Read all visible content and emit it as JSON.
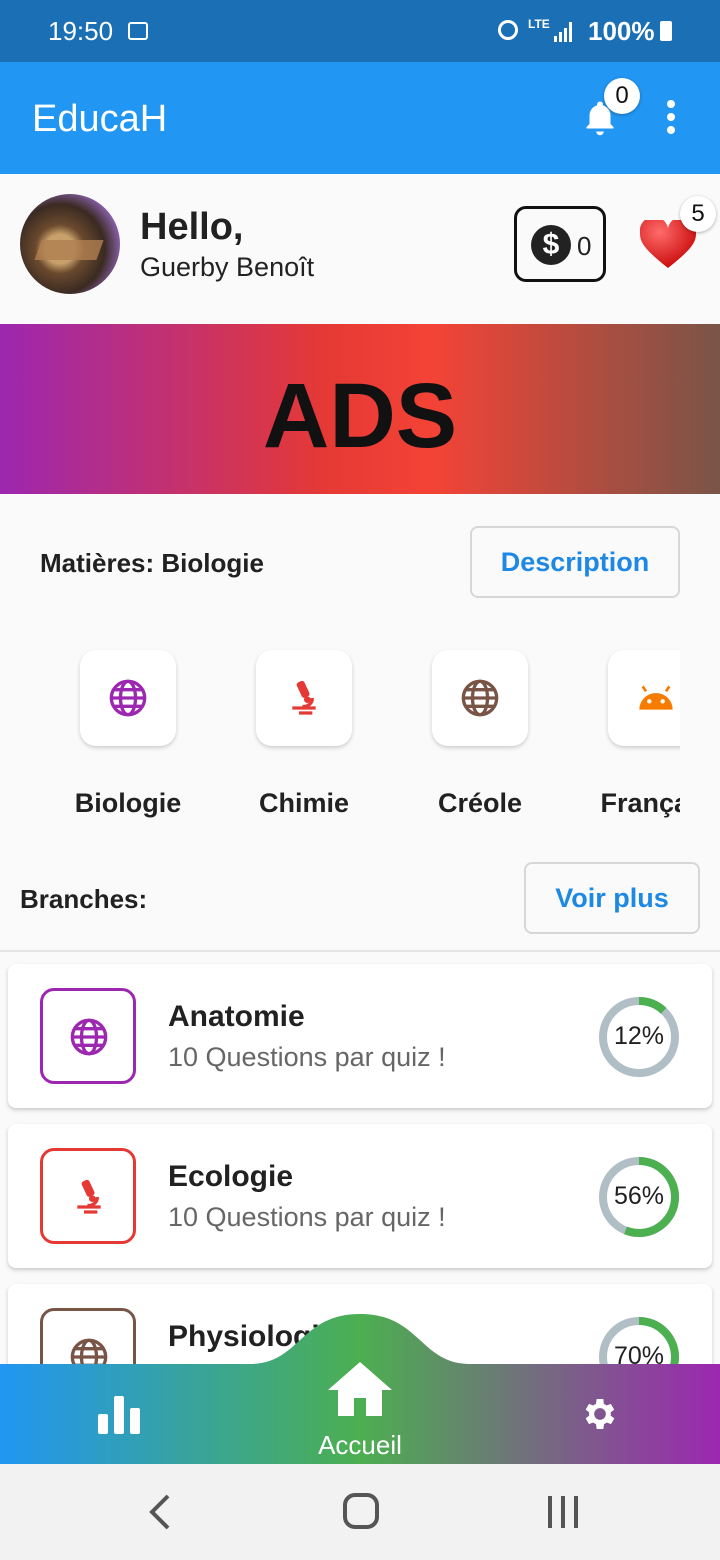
{
  "status_bar": {
    "time": "19:50",
    "network": "LTE",
    "battery": "100%"
  },
  "app_bar": {
    "title": "EducaH",
    "notification_count": "0"
  },
  "profile": {
    "greeting": "Hello,",
    "name": "Guerby Benoît",
    "coins": "0",
    "lives": "5"
  },
  "ads": {
    "text": "ADS"
  },
  "subjects_section": {
    "label": "Matières: Biologie",
    "description_button": "Description",
    "items": [
      {
        "label": "Biologie",
        "icon": "globe-icon",
        "color": "#9c27b0"
      },
      {
        "label": "Chimie",
        "icon": "microscope-icon",
        "color": "#e53935"
      },
      {
        "label": "Créole",
        "icon": "globe-icon",
        "color": "#795548"
      },
      {
        "label": "Français",
        "icon": "android-icon",
        "color": "#f57c00"
      }
    ]
  },
  "branches_section": {
    "label": "Branches:",
    "more_button": "Voir plus",
    "items": [
      {
        "name": "Anatomie",
        "subtitle": "10 Questions par quiz !",
        "progress": 12,
        "progress_text": "12%",
        "icon": "globe-icon",
        "color": "#9c27b0"
      },
      {
        "name": "Ecologie",
        "subtitle": "10 Questions par quiz !",
        "progress": 56,
        "progress_text": "56%",
        "icon": "microscope-icon",
        "color": "#e53935"
      },
      {
        "name": "Physiologie",
        "subtitle": "",
        "progress": 70,
        "progress_text": "70%",
        "icon": "globe-icon",
        "color": "#795548"
      }
    ]
  },
  "bottom_nav": {
    "home_label": "Accueil"
  },
  "colors": {
    "primary": "#2196f3",
    "status_bar": "#1a6fb5",
    "progress": "#4caf50",
    "progress_track": "#b0bec5",
    "link": "#1e88e5"
  }
}
